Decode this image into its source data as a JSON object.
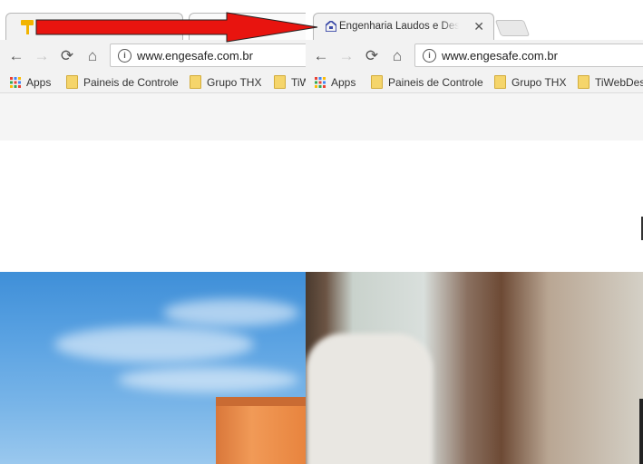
{
  "windows": {
    "left": {
      "url": "www.engesafe.com.br",
      "bookmarks": [
        {
          "label": "Apps",
          "type": "apps"
        },
        {
          "label": "Paineis de Controle",
          "type": "folder"
        },
        {
          "label": "Grupo THX",
          "type": "folder"
        },
        {
          "label": "TiW",
          "type": "folder"
        }
      ]
    },
    "right": {
      "tab_title": "Engenharia Laudos e Des",
      "tab_close": "✕",
      "url": "www.engesafe.com.br",
      "bookmarks": [
        {
          "label": "Apps",
          "type": "apps"
        },
        {
          "label": "Paineis de Controle",
          "type": "folder"
        },
        {
          "label": "Grupo THX",
          "type": "folder"
        },
        {
          "label": "TiWebDes",
          "type": "folder"
        }
      ]
    }
  },
  "icons": {
    "back": "arrow-left-icon",
    "forward": "arrow-right-icon",
    "reload": "reload-icon",
    "home": "home-icon",
    "info": "info-icon"
  },
  "colors": {
    "annotation_arrow": "#e8140f",
    "favicon_left": "#f2b400",
    "favicon_right": "#3b4aa8"
  }
}
